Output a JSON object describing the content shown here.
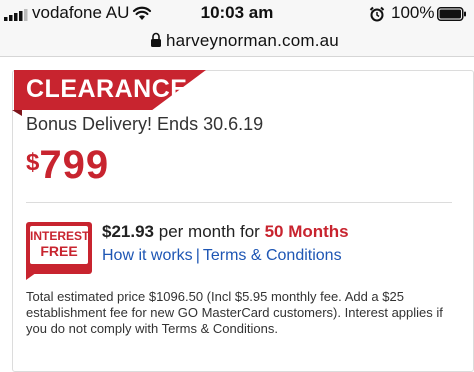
{
  "status_bar": {
    "carrier": "vodafone AU",
    "time": "10:03 am",
    "battery": "100%",
    "icons": [
      "signal-icon",
      "wifi-icon",
      "alarm-icon",
      "battery-icon"
    ]
  },
  "browser": {
    "url": "harveynorman.com.au",
    "icons": [
      "lock-icon"
    ]
  },
  "product": {
    "badge": "CLEARANCE",
    "promo": "Bonus Delivery! Ends 30.6.19",
    "currency": "$",
    "price": "799"
  },
  "finance": {
    "badge_line1": "INTEREST",
    "badge_line2": "FREE",
    "monthly_amount": "$21.93",
    "per_month_text": "per month for",
    "months": "50 Months",
    "how_it_works": "How it works",
    "separator": "|",
    "terms": "Terms & Conditions",
    "disclaimer": "Total estimated price $1096.50 (Incl $5.95 monthly fee. Add a $25 establishment fee for new GO MasterCard customers). Interest applies if you do not comply with Terms & Conditions."
  },
  "colors": {
    "brand_red": "#c8242f",
    "link_blue": "#1e56b4",
    "text_dark": "#222222",
    "status_bg": "#f7f7f7"
  }
}
